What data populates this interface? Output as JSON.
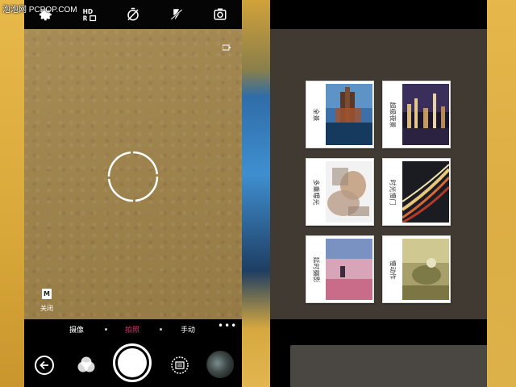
{
  "watermark": "泡泡网 PCPOP.COM",
  "camera": {
    "topbar_icons": [
      "settings-icon",
      "hdr-icon",
      "timer-off-icon",
      "flash-off-icon",
      "switch-camera-icon"
    ],
    "hdr_label": "HDR",
    "close_chip": "M",
    "close_label": "关闭",
    "modes": [
      {
        "label": "摄像",
        "active": false
      },
      {
        "label": "拍照",
        "active": true
      },
      {
        "label": "手动",
        "active": false
      }
    ],
    "more_label": "•••",
    "active_color": "#e0336e"
  },
  "mode_menu": {
    "cards": [
      {
        "label": "全景"
      },
      {
        "label": "超级夜景"
      },
      {
        "label": "多重曝光"
      },
      {
        "label": "时光慢门"
      },
      {
        "label": "延时摄影"
      },
      {
        "label": "慢动作"
      }
    ]
  }
}
